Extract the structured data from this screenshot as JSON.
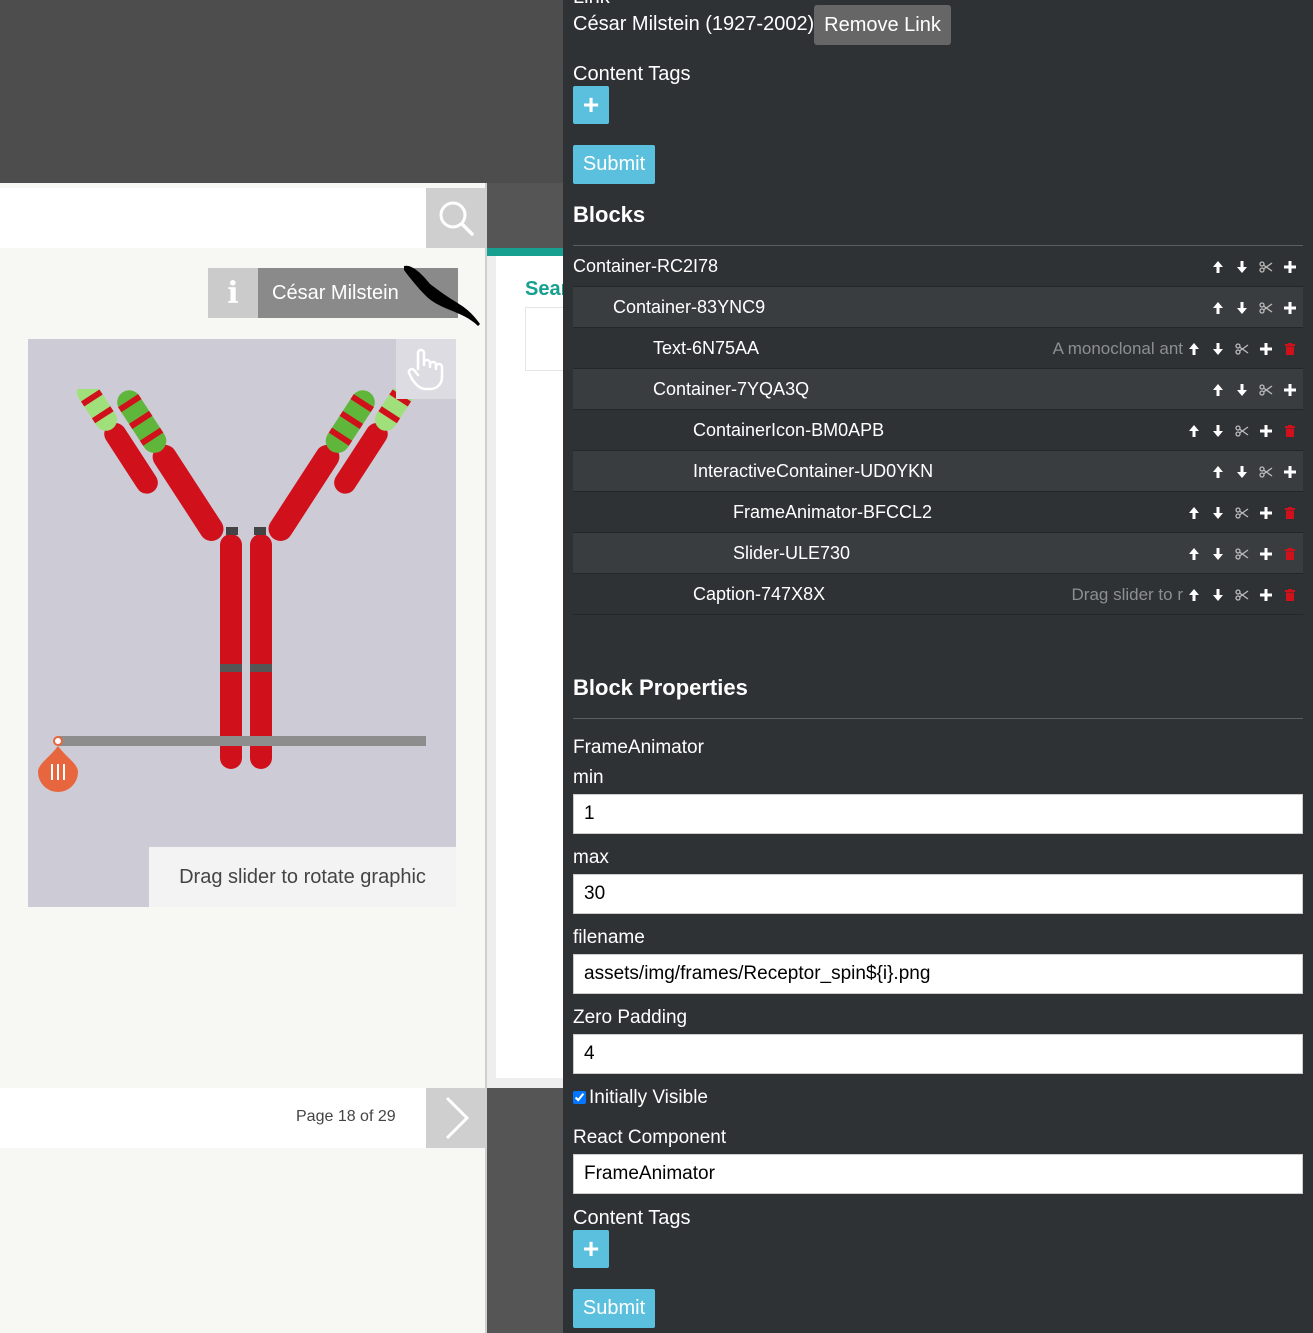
{
  "preview": {
    "search_partial": "Sear",
    "info_label": "i",
    "person_name": "César Milstein",
    "caption": "Drag slider to rotate graphic",
    "page_indicator": "Page 18 of 29"
  },
  "panel": {
    "link_heading_partial": "Link",
    "link_text": "César Milstein (1927-2002)",
    "remove_link_label": "Remove Link",
    "content_tags_label": "Content Tags",
    "add_tag_label": "+",
    "submit_label": "Submit",
    "blocks_heading": "Blocks",
    "blocks": [
      {
        "label": "Container-RC2I78",
        "preview": "",
        "deletable": false
      },
      {
        "label": "Container-83YNC9",
        "preview": "",
        "deletable": false
      },
      {
        "label": "Text-6N75AA",
        "preview": "A monoclonal ant",
        "deletable": true
      },
      {
        "label": "Container-7YQA3Q",
        "preview": "",
        "deletable": false
      },
      {
        "label": "ContainerIcon-BM0APB",
        "preview": "",
        "deletable": true
      },
      {
        "label": "InteractiveContainer-UD0YKN",
        "preview": "",
        "deletable": false
      },
      {
        "label": "FrameAnimator-BFCCL2",
        "preview": "",
        "deletable": true
      },
      {
        "label": "Slider-ULE730",
        "preview": "",
        "deletable": true
      },
      {
        "label": "Caption-747X8X",
        "preview": "Drag slider to r",
        "deletable": true
      }
    ],
    "props_heading": "Block Properties",
    "props_type": "FrameAnimator",
    "fields": {
      "min_label": "min",
      "min_value": "1",
      "max_label": "max",
      "max_value": "30",
      "filename_label": "filename",
      "filename_value": "assets/img/frames/Receptor_spin${i}.png",
      "padding_label": "Zero Padding",
      "padding_value": "4",
      "visible_label": "Initially Visible",
      "visible_checked": true,
      "component_label": "React Component",
      "component_value": "FrameAnimator"
    },
    "content_tags_label_2": "Content Tags",
    "submit_label_2": "Submit"
  },
  "colors": {
    "panel_bg": "#2f3234",
    "accent_blue": "#5bc0de",
    "teal": "#17a08f",
    "slider_orange": "#e8663d",
    "antibody_red": "#d0101a",
    "antibody_green": "#5fb63a"
  },
  "icons": [
    "search-icon",
    "info-icon",
    "hand-pointer-icon",
    "chevron-right-icon",
    "arrow-up-icon",
    "arrow-down-icon",
    "scissors-icon",
    "plus-icon",
    "trash-icon"
  ]
}
